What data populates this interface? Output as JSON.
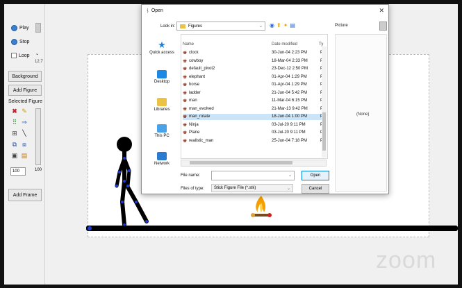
{
  "toolbar": {
    "play_label": "Play",
    "stop_label": "Stop",
    "loop_label": "Loop",
    "fps_value": "12.7",
    "background_label": "Background",
    "add_figure_label": "Add Figure",
    "selected_figure_label": "Selected Figure",
    "scale_value": "100",
    "size_value": "100",
    "add_frame_label": "Add Frame"
  },
  "dialog": {
    "title": "Open",
    "look_in_label": "Look in:",
    "look_in_value": "Figures",
    "picture_label": "Picture",
    "preview_text": "(None)",
    "columns": {
      "name": "Name",
      "date": "Date modified",
      "type": "Ty"
    },
    "places": [
      "Quick access",
      "Desktop",
      "Libraries",
      "This PC",
      "Network"
    ],
    "files": [
      {
        "name": "clock",
        "date": "30-Jun-04 2:23 PM",
        "type": "Pi"
      },
      {
        "name": "cowboy",
        "date": "18-Mar-04 2:33 PM",
        "type": "Pi"
      },
      {
        "name": "default_pivot2",
        "date": "23-Dec-12 2:50 PM",
        "type": "Pi"
      },
      {
        "name": "elephant",
        "date": "01-Apr-04 1:29 PM",
        "type": "Pi"
      },
      {
        "name": "horse",
        "date": "01-Apr-04 1:29 PM",
        "type": "Pi"
      },
      {
        "name": "ladder",
        "date": "21-Jun-04 5:42 PM",
        "type": "Pi"
      },
      {
        "name": "man",
        "date": "11-Mar-04 6:15 PM",
        "type": "Pi"
      },
      {
        "name": "man_evolved",
        "date": "21-Mar-13 9:42 PM",
        "type": "Pi"
      },
      {
        "name": "man_rotate",
        "date": "18-Jun-04 1:00 PM",
        "type": "Pi"
      },
      {
        "name": "Ninja",
        "date": "03-Jul-20 9:11 PM",
        "type": "Pi"
      },
      {
        "name": "Plane",
        "date": "03-Jul-20 9:11 PM",
        "type": "Pi"
      },
      {
        "name": "realistic_man",
        "date": "25-Jun-04 7:18 PM",
        "type": "Pi"
      }
    ],
    "file_name_label": "File name:",
    "file_name_value": "",
    "files_of_type_label": "Files of type:",
    "files_of_type_value": "Stick Figure File (*.stk)",
    "open_label": "Open",
    "cancel_label": "Cancel"
  },
  "watermark": "zoom",
  "colors": {
    "accent": "#0078d7",
    "selection": "#cce4f7",
    "figure": "#000000",
    "joint": "#1a3fd6"
  }
}
